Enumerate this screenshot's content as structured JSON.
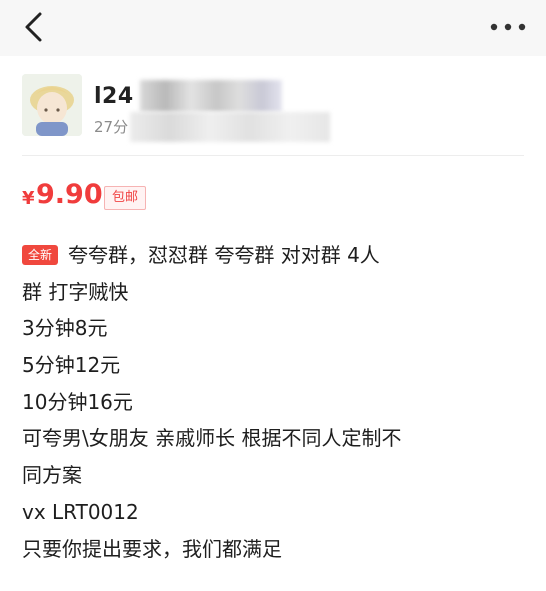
{
  "nav": {
    "back_icon": "chevron-left-icon",
    "more_icon": "more-dots-icon"
  },
  "seller": {
    "name_visible": "l24",
    "time_visible": "27分"
  },
  "listing": {
    "price_symbol": "¥",
    "price": "9.90",
    "shipping_badge": "包邮",
    "new_badge": "全新",
    "description_lines": [
      "夸夸群，怼怼群 夸夸群 对对群 4人",
      "群 打字贼快",
      "3分钟8元",
      "5分钟12元",
      "10分钟16元",
      "可夸男\\女朋友 亲戚师长 根据不同人定制不",
      "同方案",
      "vx LRT0012",
      "只要你提出要求，我们都满足"
    ]
  },
  "colors": {
    "price_red": "#f03c3c",
    "badge_red": "#f0483e",
    "page_bg": "#f7f7f7",
    "card_bg": "#ffffff"
  }
}
